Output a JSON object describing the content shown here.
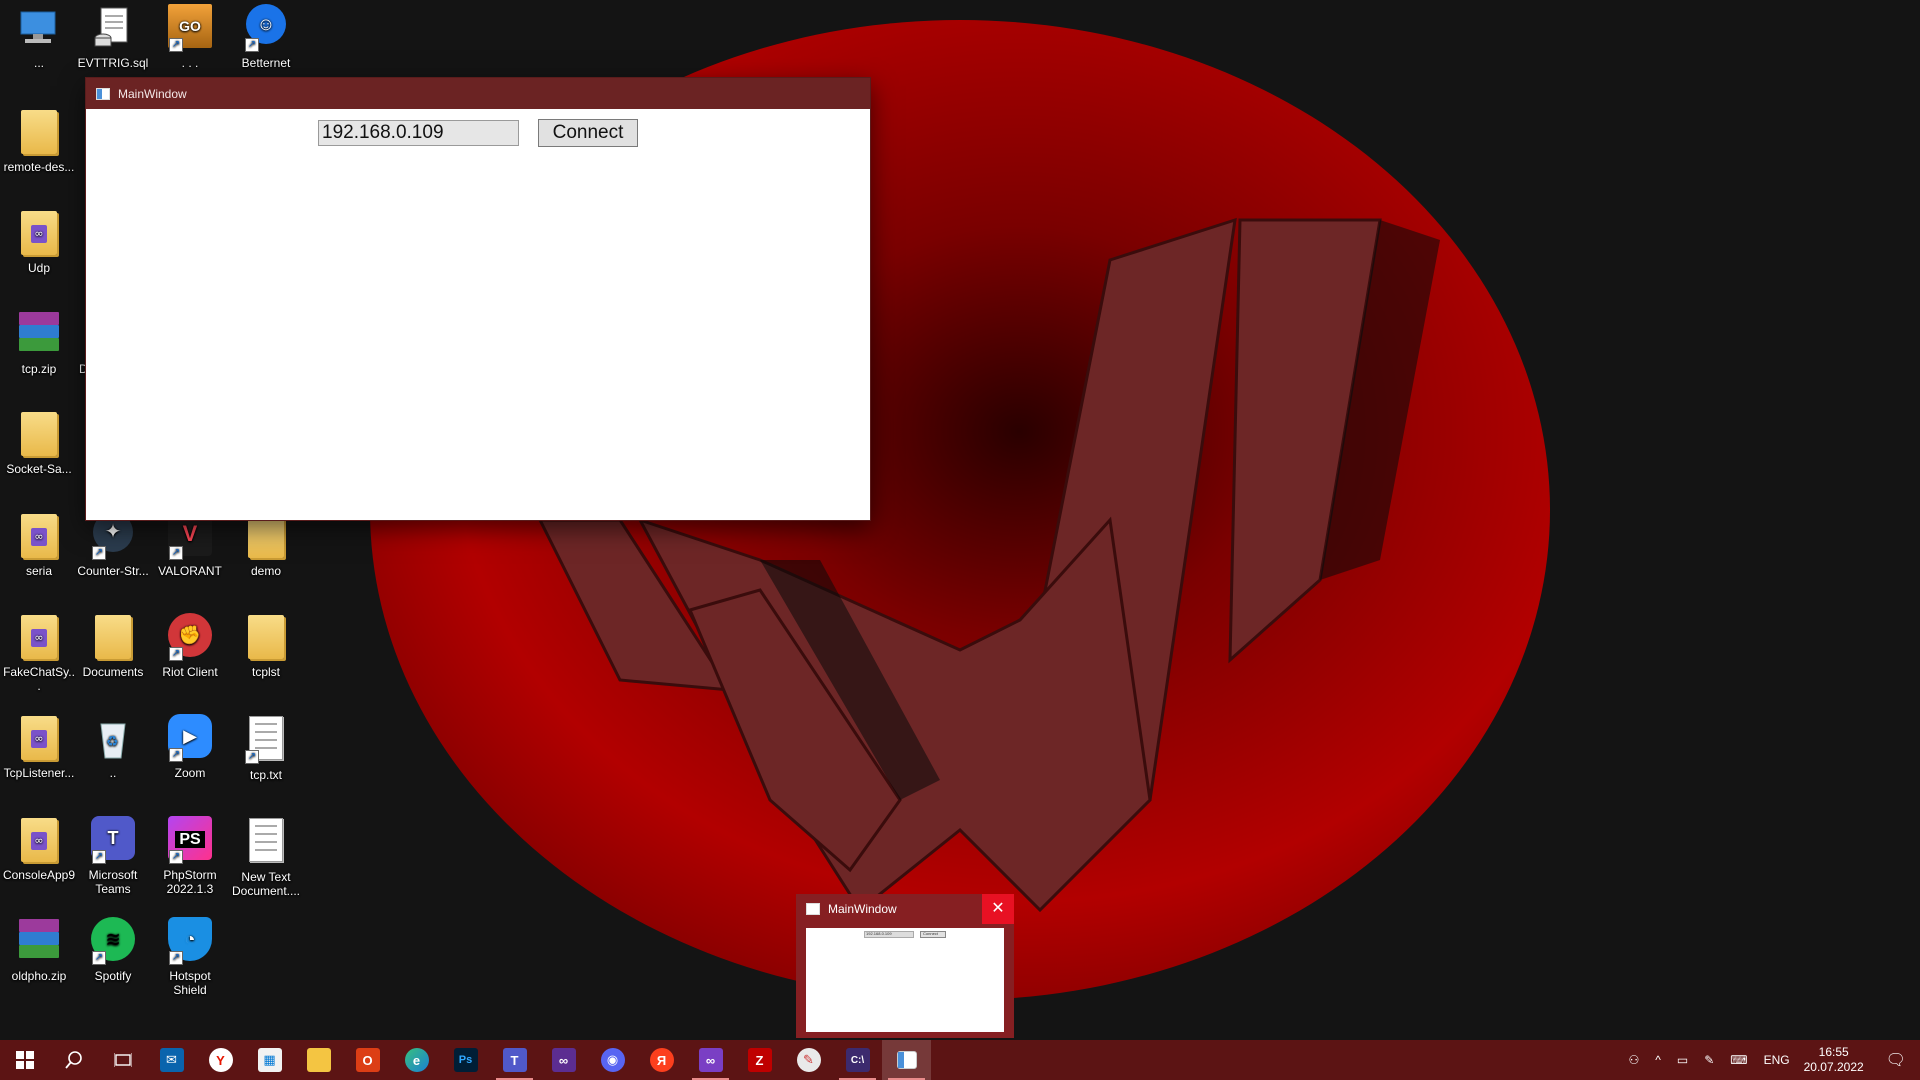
{
  "desktop": {
    "icons": [
      {
        "label": "...",
        "icon": "this-pc-icon"
      },
      {
        "label": "EVTTRIG.sql",
        "icon": "sql-file-icon"
      },
      {
        "label": ". . .",
        "icon": "csgo-icon"
      },
      {
        "label": "Betternet",
        "icon": "betternet-icon"
      },
      {
        "label": "remote-des...",
        "icon": "folder-icon"
      },
      {
        "label": "Udp",
        "icon": "vs-folder-icon"
      },
      {
        "label": "tcp.zip",
        "icon": "winrar-icon"
      },
      {
        "label": "Socket-Sa...",
        "icon": "folder-icon"
      },
      {
        "label": "seria",
        "icon": "vs-folder-icon"
      },
      {
        "label": "Counter-Str...",
        "icon": "counter-strike-icon"
      },
      {
        "label": "VALORANT",
        "icon": "valorant-icon"
      },
      {
        "label": "demo",
        "icon": "folder-icon"
      },
      {
        "label": "FakeChatSy...",
        "icon": "vs-folder-icon"
      },
      {
        "label": "Documents",
        "icon": "folder-icon"
      },
      {
        "label": "Riot Client",
        "icon": "riot-client-icon"
      },
      {
        "label": "tcplst",
        "icon": "folder-icon"
      },
      {
        "label": "TcpListener...",
        "icon": "vs-folder-icon"
      },
      {
        "label": "..",
        "icon": "recycle-bin-icon"
      },
      {
        "label": "Zoom",
        "icon": "zoom-icon"
      },
      {
        "label": "tcp.txt",
        "icon": "text-file-icon"
      },
      {
        "label": "ConsoleApp9",
        "icon": "vs-folder-icon"
      },
      {
        "label": "Microsoft Teams",
        "icon": "teams-icon"
      },
      {
        "label": "PhpStorm 2022.1.3",
        "icon": "phpstorm-icon"
      },
      {
        "label": "New Text Document....",
        "icon": "text-file-icon"
      },
      {
        "label": "oldpho.zip",
        "icon": "winrar-icon"
      },
      {
        "label": "Spotify",
        "icon": "spotify-icon"
      },
      {
        "label": "Hotspot Shield",
        "icon": "hotspot-shield-icon"
      }
    ],
    "partial_label": "D"
  },
  "main_window": {
    "title": "MainWindow",
    "ip_value": "192.168.0.109",
    "connect_label": "Connect"
  },
  "taskbar_preview": {
    "title": "MainWindow",
    "close_glyph": "✕",
    "mini_ip": "192.168.0.109",
    "mini_connect": "Connect"
  },
  "taskbar": {
    "apps": [
      {
        "icon": "start-icon"
      },
      {
        "icon": "search-icon"
      },
      {
        "icon": "task-view-icon"
      },
      {
        "icon": "mail-icon"
      },
      {
        "icon": "yandex-browser-icon"
      },
      {
        "icon": "store-icon"
      },
      {
        "icon": "file-explorer-icon"
      },
      {
        "icon": "office-icon"
      },
      {
        "icon": "edge-icon"
      },
      {
        "icon": "photoshop-icon"
      },
      {
        "icon": "teams-icon"
      },
      {
        "icon": "visual-studio-icon"
      },
      {
        "icon": "discord-icon"
      },
      {
        "icon": "yandex-icon"
      },
      {
        "icon": "visual-studio-2022-icon"
      },
      {
        "icon": "filezilla-icon"
      },
      {
        "icon": "paint-icon"
      },
      {
        "icon": "console-icon"
      },
      {
        "icon": "mainwindow-app-icon"
      }
    ],
    "tray": {
      "language": "ENG",
      "time": "16:55",
      "date": "20.07.2022"
    }
  },
  "colors": {
    "titlebar": "#6b2323",
    "taskbar": "#5c1414",
    "wallpaper_red": "#b00000",
    "close_red": "#e81123"
  }
}
